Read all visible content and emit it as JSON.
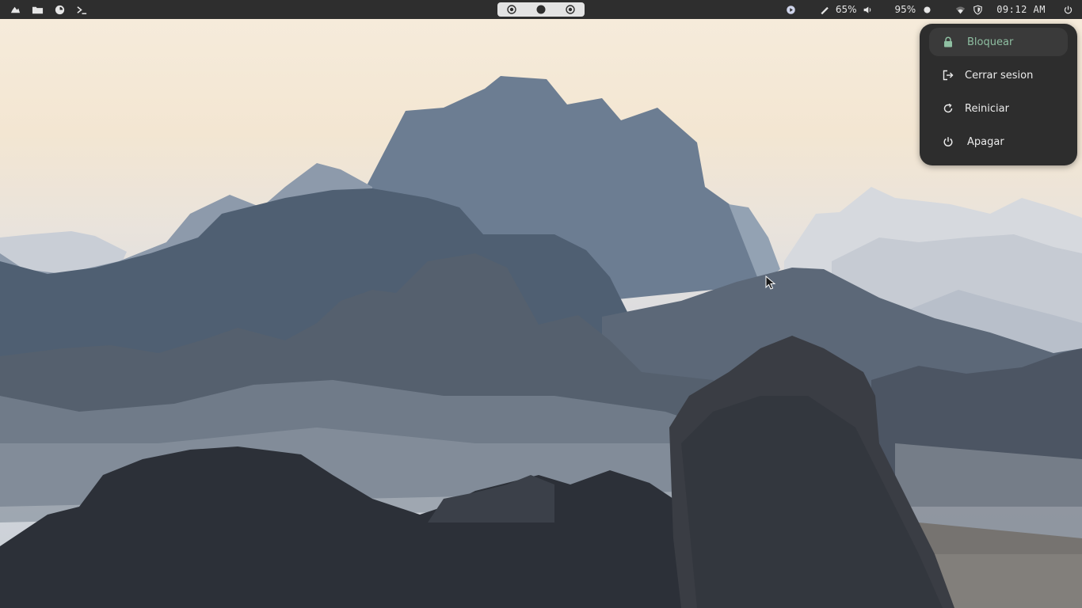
{
  "topbar": {
    "left_icons": [
      "cloud-icon",
      "folder-icon",
      "browser-icon",
      "terminal-icon"
    ],
    "workspaces": [
      "workspace-1",
      "workspace-2",
      "workspace-3"
    ],
    "active_workspace": 2,
    "status": {
      "play_icon": "play-circle-icon",
      "brightness_icon": "brightness-pen-icon",
      "brightness_value": "65%",
      "volume_icon": "speaker-icon",
      "volume_value": "95%",
      "battery_icon": "circle-icon",
      "wifi_icon": "wifi-icon",
      "vpn_icon": "shield-icon",
      "clock": "09:12 AM",
      "power_icon": "power-icon"
    }
  },
  "power_menu": {
    "items": [
      {
        "label": "Bloquear",
        "icon": "lock-icon",
        "active": true
      },
      {
        "label": "Cerrar sesion",
        "icon": "logout-icon",
        "active": false
      },
      {
        "label": "Reiniciar",
        "icon": "restart-icon",
        "active": false
      },
      {
        "label": "Apagar",
        "icon": "power-icon",
        "active": false
      }
    ]
  },
  "colors": {
    "bar_bg": "#2e2e2e",
    "menu_bg": "#2d2d2d",
    "accent_green": "#8fbfa2",
    "workspace_bg": "#e3e3e3"
  }
}
